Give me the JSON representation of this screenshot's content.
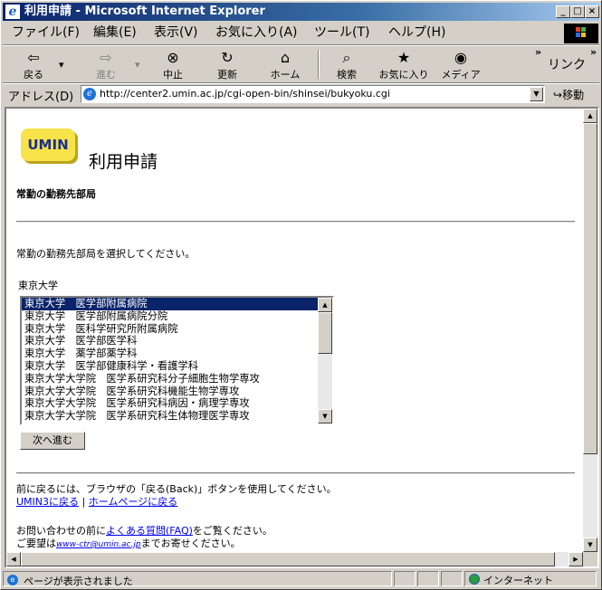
{
  "window": {
    "title": "利用申請 - Microsoft Internet Explorer",
    "buttons": {
      "minimize": "_",
      "maximize": "□",
      "close": "×"
    }
  },
  "menubar": {
    "items": [
      "ファイル(F)",
      "編集(E)",
      "表示(V)",
      "お気に入り(A)",
      "ツール(T)",
      "ヘルプ(H)"
    ]
  },
  "toolbar": {
    "back": "戻る",
    "forward": "進む",
    "stop": "中止",
    "refresh": "更新",
    "home": "ホーム",
    "search": "検索",
    "favorites": "お気に入り",
    "media": "メディア",
    "links": "リンク",
    "more": "»"
  },
  "address": {
    "label": "アドレス(D)",
    "url": "http://center2.umin.ac.jp/cgi-open-bin/shinsei/bukyoku.cgi",
    "go": "移動"
  },
  "page": {
    "logo": "UMIN",
    "title": "利用申請",
    "section_title": "常勤の勤務先部局",
    "instruction": "常勤の勤務先部局を選択してください。",
    "university": "東京大学",
    "departments": [
      "東京大学　医学部附属病院",
      "東京大学　医学部附属病院分院",
      "東京大学　医科学研究所附属病院",
      "東京大学　医学部医学科",
      "東京大学　薬学部薬学科",
      "東京大学　医学部健康科学・看護学科",
      "東京大学大学院　医学系研究科分子細胞生物学専攻",
      "東京大学大学院　医学系研究科機能生物学専攻",
      "東京大学大学院　医学系研究科病因・病理学専攻",
      "東京大学大学院　医学系研究科生体物理医学専攻"
    ],
    "selected_index": 0,
    "next_button": "次へ進む",
    "back_text": "前に戻るには、ブラウザの「戻る(Back)」ボタンを使用してください。",
    "link_umin3": "UMIN3に戻る",
    "link_separator": "|",
    "link_home": "ホームページに戻る",
    "faq_prefix": "お問い合わせの前に",
    "faq_link": "よくある質問(FAQ)",
    "faq_suffix": "をご覧ください。",
    "request_prefix": "ご要望は",
    "email": "www-ctr@umin.ac.jp",
    "request_suffix": "までお寄せください。"
  },
  "status": {
    "text": "ページが表示されました",
    "zone": "インターネット"
  }
}
